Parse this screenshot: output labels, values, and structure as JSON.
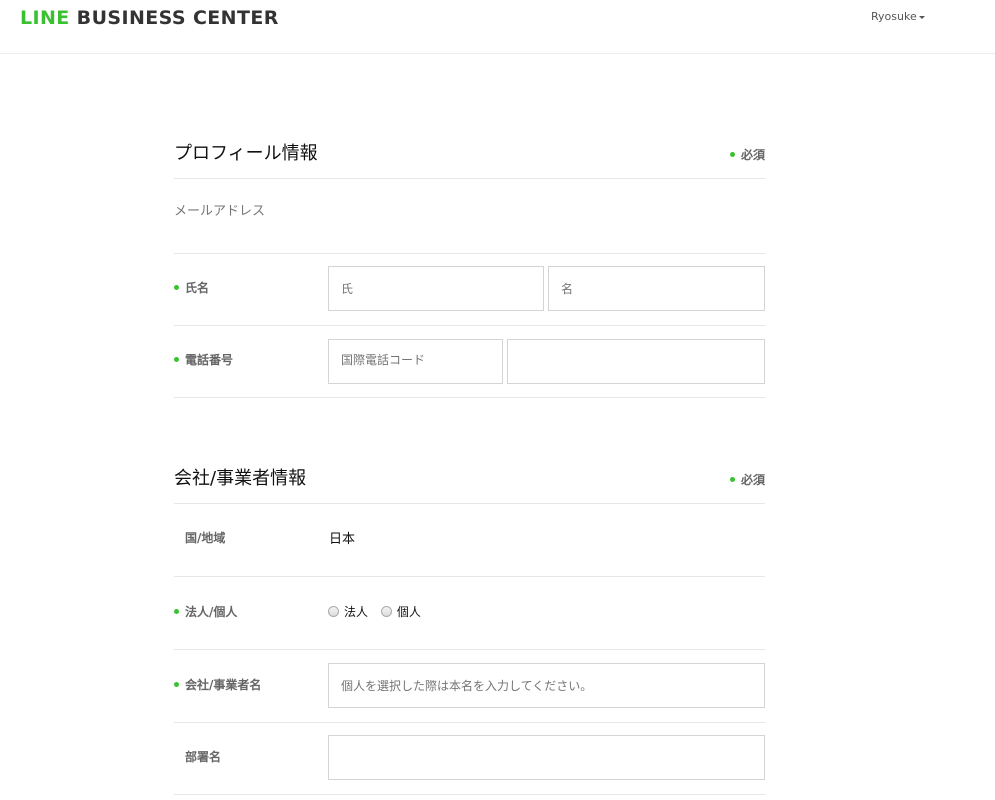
{
  "header": {
    "logo_line": "LINE",
    "logo_rest": " BUSINESS CENTER",
    "user_name": "Ryosuke",
    "brand_color": "#3ac132"
  },
  "profile": {
    "title": "プロフィール情報",
    "required_label": "必須",
    "email_label": "メールアドレス",
    "name_label": "氏名",
    "last_name_placeholder": "氏",
    "first_name_placeholder": "名",
    "phone_label": "電話番号",
    "country_code_placeholder": "国際電話コード",
    "phone_placeholder": ""
  },
  "company": {
    "title": "会社/事業者情報",
    "required_label": "必須",
    "country_label": "国/地域",
    "country_value": "日本",
    "entity_type_label": "法人/個人",
    "entity_options": [
      "法人",
      "個人"
    ],
    "company_name_label": "会社/事業者名",
    "company_name_placeholder": "個人を選択した際は本名を入力してください。",
    "department_label": "部署名",
    "department_placeholder": ""
  }
}
